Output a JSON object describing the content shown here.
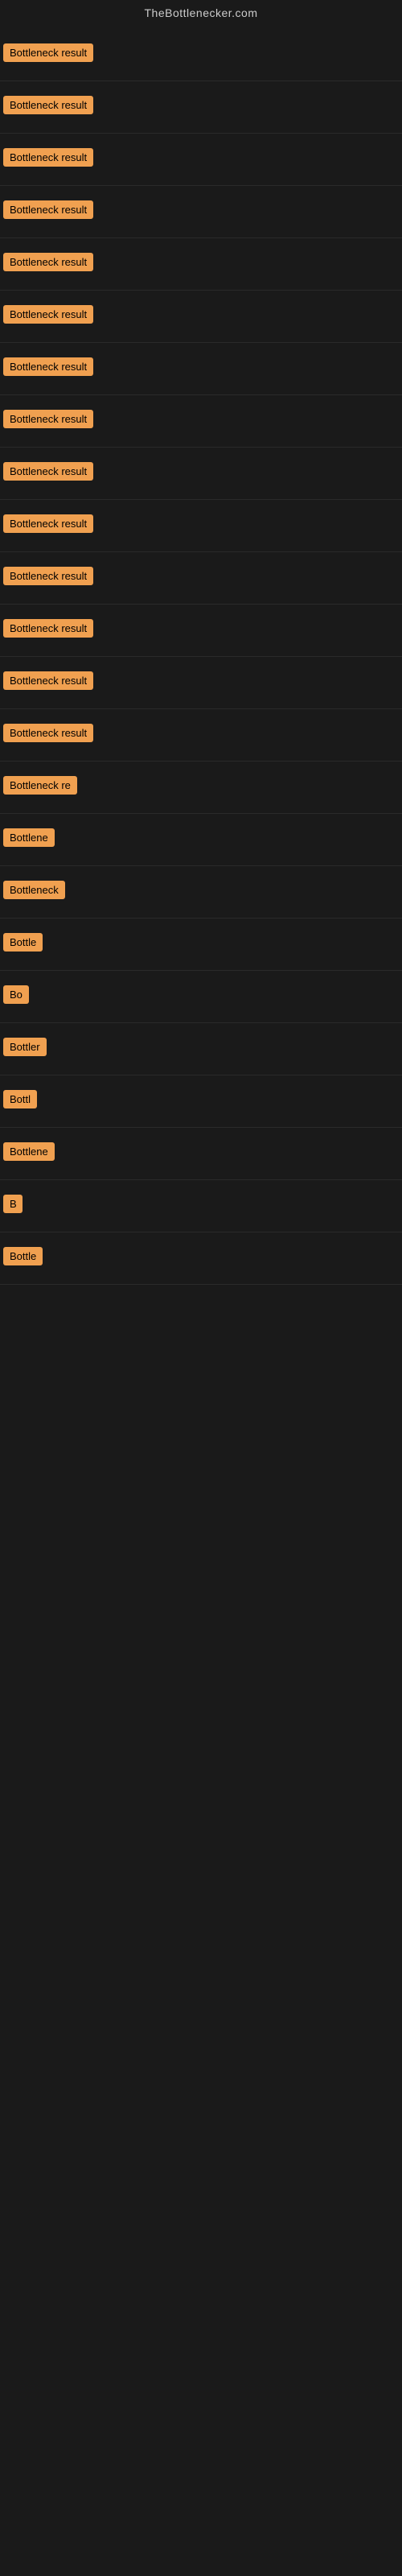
{
  "site": {
    "title": "TheBottlenecker.com"
  },
  "rows": [
    {
      "id": 1,
      "label": "Bottleneck result",
      "width": 130
    },
    {
      "id": 2,
      "label": "Bottleneck result",
      "width": 130
    },
    {
      "id": 3,
      "label": "Bottleneck result",
      "width": 130
    },
    {
      "id": 4,
      "label": "Bottleneck result",
      "width": 130
    },
    {
      "id": 5,
      "label": "Bottleneck result",
      "width": 130
    },
    {
      "id": 6,
      "label": "Bottleneck result",
      "width": 130
    },
    {
      "id": 7,
      "label": "Bottleneck result",
      "width": 130
    },
    {
      "id": 8,
      "label": "Bottleneck result",
      "width": 130
    },
    {
      "id": 9,
      "label": "Bottleneck result",
      "width": 130
    },
    {
      "id": 10,
      "label": "Bottleneck result",
      "width": 130
    },
    {
      "id": 11,
      "label": "Bottleneck result",
      "width": 130
    },
    {
      "id": 12,
      "label": "Bottleneck result",
      "width": 125
    },
    {
      "id": 13,
      "label": "Bottleneck result",
      "width": 120
    },
    {
      "id": 14,
      "label": "Bottleneck result",
      "width": 118
    },
    {
      "id": 15,
      "label": "Bottleneck re",
      "width": 100
    },
    {
      "id": 16,
      "label": "Bottlene",
      "width": 80
    },
    {
      "id": 17,
      "label": "Bottleneck",
      "width": 85
    },
    {
      "id": 18,
      "label": "Bottle",
      "width": 65
    },
    {
      "id": 19,
      "label": "Bo",
      "width": 35
    },
    {
      "id": 20,
      "label": "Bottler",
      "width": 68
    },
    {
      "id": 21,
      "label": "Bottl",
      "width": 52
    },
    {
      "id": 22,
      "label": "Bottlene",
      "width": 80
    },
    {
      "id": 23,
      "label": "B",
      "width": 24
    },
    {
      "id": 24,
      "label": "Bottle",
      "width": 60
    }
  ]
}
